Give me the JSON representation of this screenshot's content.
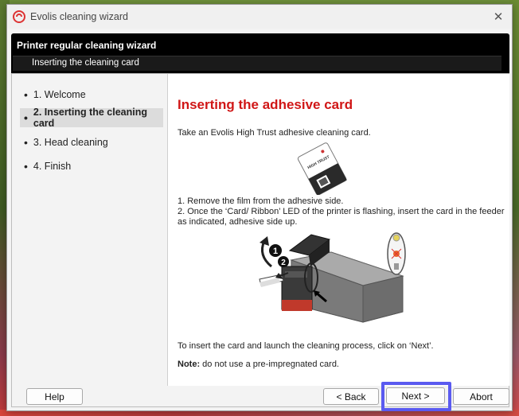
{
  "window": {
    "title": "Evolis cleaning wizard",
    "close_glyph": "✕"
  },
  "header": {
    "title": "Printer regular cleaning wizard",
    "subtitle": "Inserting the cleaning card"
  },
  "sidebar": {
    "items": [
      {
        "label": "1. Welcome",
        "active": false
      },
      {
        "label": "2. Inserting the cleaning card",
        "active": true
      },
      {
        "label": "3. Head cleaning",
        "active": false
      },
      {
        "label": "4. Finish",
        "active": false
      }
    ],
    "bullet": "•"
  },
  "main": {
    "heading": "Inserting the adhesive card",
    "intro": "Take an Evolis High Trust adhesive cleaning card.",
    "step1": "1. Remove the film from the adhesive side.",
    "step2_line1": "2. Once the ‘Card/ Ribbon’ LED of the printer is flashing, insert the card in the feeder",
    "step2_line2": "as indicated, adhesive side up.",
    "launch": "To insert the card and launch the cleaning process, click on ‘Next’.",
    "note_label": "Note:",
    "note_text": " do not use a pre-impregnated card.",
    "card_label": "HIGH TRUST",
    "callout_1": "1",
    "callout_2": "2"
  },
  "buttons": {
    "help": "Help",
    "back": "< Back",
    "next": "Next >",
    "abort": "Abort"
  },
  "colors": {
    "heading": "#d01616",
    "focus_ring": "#5a5af0",
    "header_bg": "#000000",
    "active_step_bg": "#dcdcdc"
  }
}
